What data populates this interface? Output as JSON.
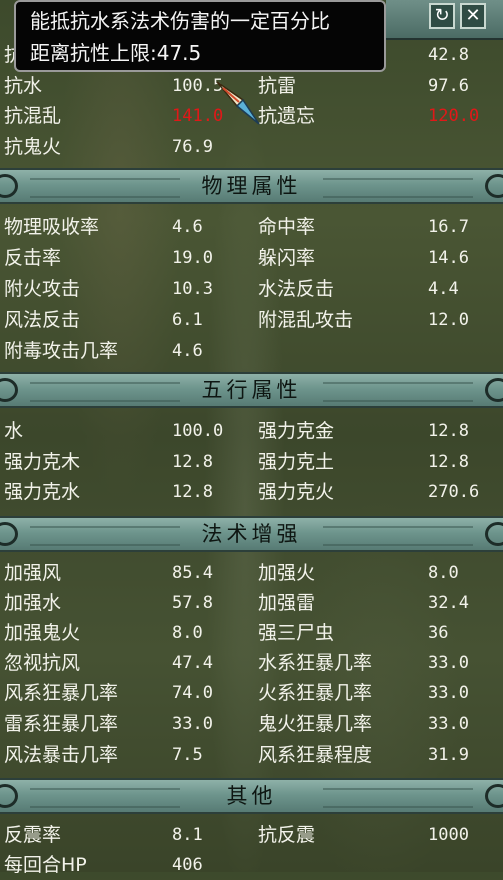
{
  "tooltip": {
    "line1": "能抵抗水系法术伤害的一定百分比",
    "line2": "距离抗性上限:47.5"
  },
  "window_buttons": {
    "refresh_glyph": "↻",
    "close_glyph": "✕"
  },
  "resist": {
    "row0": {
      "l1": "抗",
      "v1": "",
      "l2": "",
      "v2": "42.8"
    },
    "row1": {
      "l1": "抗水",
      "v1": "100.5",
      "l2": "抗雷",
      "v2": "97.6"
    },
    "row2": {
      "l1": "抗混乱",
      "v1": "141.0",
      "l2": "抗遗忘",
      "v2": "120.0"
    },
    "row3": {
      "l1": "抗鬼火",
      "v1": "76.9"
    }
  },
  "sections": {
    "physical": {
      "title": "物理属性",
      "rows": [
        {
          "l1": "物理吸收率",
          "v1": "4.6",
          "l2": "命中率",
          "v2": "16.7"
        },
        {
          "l1": "反击率",
          "v1": "19.0",
          "l2": "躲闪率",
          "v2": "14.6"
        },
        {
          "l1": "附火攻击",
          "v1": "10.3",
          "l2": "水法反击",
          "v2": "4.4"
        },
        {
          "l1": "风法反击",
          "v1": "6.1",
          "l2": "附混乱攻击",
          "v2": "12.0"
        },
        {
          "l1": "附毒攻击几率",
          "v1": "4.6"
        }
      ]
    },
    "five": {
      "title": "五行属性",
      "rows": [
        {
          "l1": "水",
          "v1": "100.0",
          "l2": "强力克金",
          "v2": "12.8"
        },
        {
          "l1": "强力克木",
          "v1": "12.8",
          "l2": "强力克土",
          "v2": "12.8"
        },
        {
          "l1": "强力克水",
          "v1": "12.8",
          "l2": "强力克火",
          "v2": "270.6"
        }
      ]
    },
    "magic": {
      "title": "法术增强",
      "rows": [
        {
          "l1": "加强风",
          "v1": "85.4",
          "l2": "加强火",
          "v2": "8.0"
        },
        {
          "l1": "加强水",
          "v1": "57.8",
          "l2": "加强雷",
          "v2": "32.4"
        },
        {
          "l1": "加强鬼火",
          "v1": "8.0",
          "l2": "强三尸虫",
          "v2": "36"
        },
        {
          "l1": "忽视抗风",
          "v1": "47.4",
          "l2": "水系狂暴几率",
          "v2": "33.0"
        },
        {
          "l1": "风系狂暴几率",
          "v1": "74.0",
          "l2": "火系狂暴几率",
          "v2": "33.0"
        },
        {
          "l1": "雷系狂暴几率",
          "v1": "33.0",
          "l2": "鬼火狂暴几率",
          "v2": "33.0"
        },
        {
          "l1": "风法暴击几率",
          "v1": "7.5",
          "l2": "风系狂暴程度",
          "v2": "31.9"
        }
      ]
    },
    "other": {
      "title": "其他",
      "rows": [
        {
          "l1": "反震率",
          "v1": "8.1",
          "l2": "抗反震",
          "v2": "1000"
        },
        {
          "l1": "每回合HP",
          "v1": "406"
        }
      ]
    }
  },
  "colors": {
    "text": "#f2f2ea",
    "highlight_red": "#e01818",
    "header_teal": "#6e958d",
    "tooltip_bg": "#050505"
  }
}
